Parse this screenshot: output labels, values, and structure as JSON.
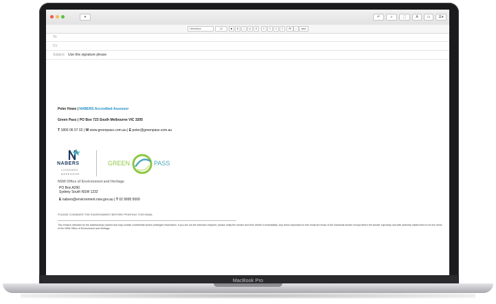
{
  "laptop": {
    "brand": "MacBook Pro"
  },
  "toolbar": {
    "dropdown_label": "▾",
    "buttons": [
      "↶",
      "⌕",
      "⬚",
      "A",
      "▭",
      "☰▾"
    ]
  },
  "format_bar": {
    "font": "Helvetica",
    "size": "12",
    "items": [
      "■",
      "B",
      "I",
      "U",
      "S",
      "≡",
      "≡",
      "≡",
      "≡",
      "⊞",
      "•",
      "◂◂ ▸"
    ]
  },
  "headers": {
    "to_label": "To:",
    "to_value": "",
    "cc_label": "Cc:",
    "cc_value": "",
    "subject_label": "Subject:",
    "subject_value": "Use this signature please"
  },
  "signature": {
    "name": "Peter Howe",
    "role": "NABERS Accredited Assessor",
    "org": "Green Pass",
    "address": "PO Box 723 South Melbourne VIC 3205",
    "phone_label": "T",
    "phone": "1800 06 07 02",
    "web_label": "W",
    "web": "www.greenpass.com.au",
    "email_label": "E",
    "email": "peter@greenpass.com.au"
  },
  "nabers_logo": {
    "word": "NABERS",
    "line1": "LICENSED",
    "line2": "ASSESSOR"
  },
  "greenpass_logo": {
    "left": "GREEN",
    "right": "PASS"
  },
  "nsw": {
    "office": "NSW Office of Environment and Heritage",
    "po_box": "PO Box A290",
    "city": "Sydney South NSW 1232",
    "email_label": "E",
    "email": "nabers@environment.nsw.gov.au",
    "phone_label": "T",
    "phone": "02 9995 5000"
  },
  "footer": {
    "environment_note": "PLEASE CONSIDER THE ENVIRONMENT BEFORE PRINTING THIS EMAIL",
    "disclaimer": "This email is intended for the addressee(s) named and may contain confidential and/or privileged information. If you are not the intended recipient, please notify the sender and then delete it immediately. Any views expressed in this email are those of the individual sender except where the sender expressly and with authority states them to be the views of the NSW Office of Environment and Heritage."
  },
  "colors": {
    "accent_blue": "#1d8fc2",
    "nabers_navy": "#1e3a5f",
    "green": "#8cc63f",
    "teal": "#4aa8b8"
  }
}
